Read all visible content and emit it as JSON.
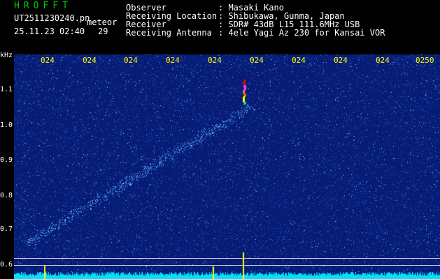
{
  "header": {
    "app_title": "HROFFT",
    "filename": "UT2511230240.pn",
    "meteor_label": "meteor",
    "datetime": "25.11.23 02:40",
    "count": "29",
    "observer_label": "Observer",
    "observer_value": ": Masaki Kano",
    "location_label": "Receiving Location",
    "location_value": ": Shibukawa, Gunma, Japan",
    "receiver_label": "Receiver",
    "receiver_value": ": SDR# 43dB L15 111.6MHz USB",
    "antenna_label": "Receiving Antenna",
    "antenna_value": ": 4ele Yagi Az 230 for Kansai VOR"
  },
  "axis": {
    "unit": "kHz",
    "y_ticks": [
      "1.1",
      "1.0",
      "0.9",
      "0.8",
      "0.7",
      "0.6"
    ],
    "x_ticks": [
      "024",
      "024",
      "024",
      "024",
      "024",
      "024",
      "024",
      "024",
      "024",
      "0250"
    ]
  },
  "colors": {
    "title": "#00c800",
    "header_text": "#ffffff",
    "time_labels": "#ffff00",
    "axis_text": "#ffffff",
    "plot_bg": "#071c74",
    "noise_floor": "#00e0ff",
    "marker": "#ffff00"
  }
}
